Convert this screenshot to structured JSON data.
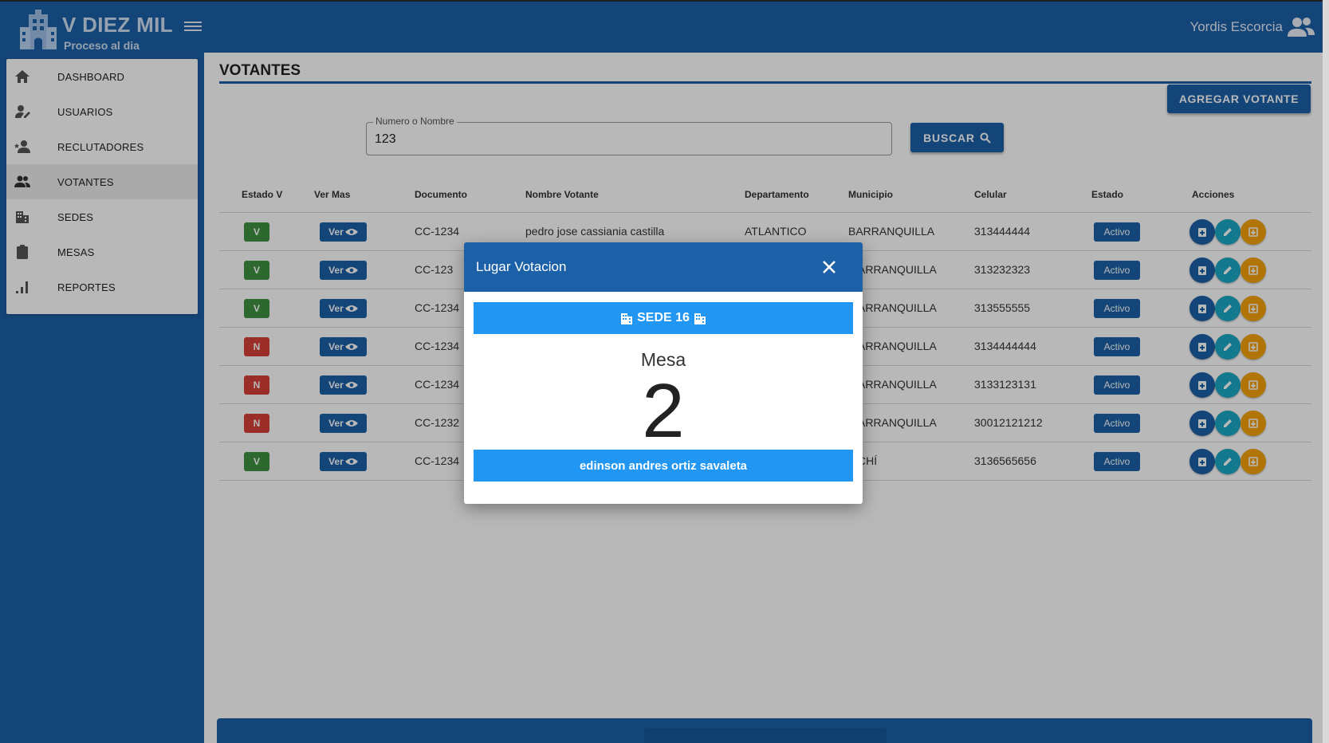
{
  "app": {
    "brand_title": "V DIEZ MIL",
    "brand_subtitle": "Proceso al dia",
    "user_name": "Yordis Escorcia"
  },
  "sidebar": {
    "items": [
      {
        "label": "DASHBOARD",
        "icon": "home-icon"
      },
      {
        "label": "USUARIOS",
        "icon": "user-edit-icon"
      },
      {
        "label": "RECLUTADORES",
        "icon": "user-star-icon"
      },
      {
        "label": "VOTANTES",
        "icon": "users-icon",
        "active": true
      },
      {
        "label": "SEDES",
        "icon": "buildings-icon"
      },
      {
        "label": "MESAS",
        "icon": "clipboard-icon"
      },
      {
        "label": "REPORTES",
        "icon": "bar-chart-icon"
      }
    ]
  },
  "main": {
    "title": "VOTANTES",
    "add_button": "AGREGAR VOTANTE",
    "search": {
      "legend": "Numero o Nombre",
      "value": "123",
      "button": "BUSCAR"
    },
    "table": {
      "headers": [
        "Estado V",
        "Ver Mas",
        "Documento",
        "Nombre Votante",
        "Departamento",
        "Municipio",
        "Celular",
        "Estado",
        "Acciones"
      ],
      "ver_label": "Ver",
      "rows": [
        {
          "estado_v": "V",
          "documento": "CC-1234",
          "nombre": "pedro jose cassiania castilla",
          "departamento": "ATLANTICO",
          "municipio": "BARRANQUILLA",
          "celular": "313444444",
          "estado": "Activo"
        },
        {
          "estado_v": "V",
          "documento": "CC-123",
          "nombre": "",
          "departamento": "",
          "municipio": "ARRANQUILLA",
          "celular": "313232323",
          "estado": "Activo"
        },
        {
          "estado_v": "V",
          "documento": "CC-1234",
          "nombre": "",
          "departamento": "",
          "municipio": "ARRANQUILLA",
          "celular": "313555555",
          "estado": "Activo"
        },
        {
          "estado_v": "N",
          "documento": "CC-1234",
          "nombre": "",
          "departamento": "",
          "municipio": "ARRANQUILLA",
          "celular": "3134444444",
          "estado": "Activo"
        },
        {
          "estado_v": "N",
          "documento": "CC-1234",
          "nombre": "",
          "departamento": "",
          "municipio": "ARRANQUILLA",
          "celular": "3133123131",
          "estado": "Activo"
        },
        {
          "estado_v": "N",
          "documento": "CC-1232",
          "nombre": "",
          "departamento": "",
          "municipio": "ARRANQUILLA",
          "celular": "30012121212",
          "estado": "Activo"
        },
        {
          "estado_v": "V",
          "documento": "CC-1234",
          "nombre": "",
          "departamento": "",
          "municipio": "CHÍ",
          "celular": "3136565656",
          "estado": "Activo"
        }
      ]
    }
  },
  "modal": {
    "title": "Lugar Votacion",
    "sede": "SEDE 16",
    "mesa_label": "Mesa",
    "mesa_number": "2",
    "person": "edinson andres ortiz savaleta"
  },
  "colors": {
    "primary": "#1c60a8",
    "accent": "#2196f3",
    "badge_v": "#3f9142",
    "badge_n": "#d9403a",
    "teal": "#1ba8c6",
    "orange": "#f4a10a"
  }
}
